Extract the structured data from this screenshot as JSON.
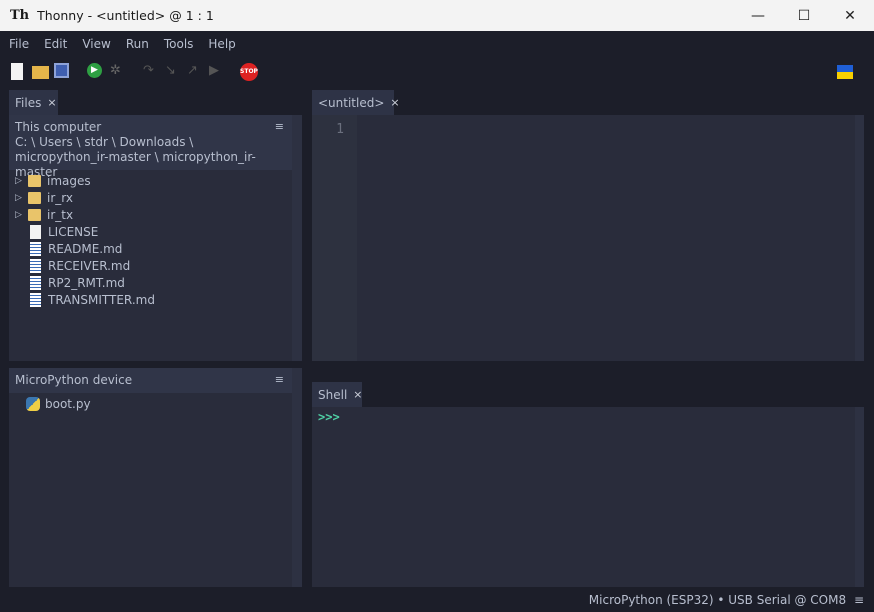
{
  "title": {
    "app": "Thonny",
    "sep": "-",
    "doc": "<untitled>",
    "pos": "@  1 : 1",
    "logo": "Th"
  },
  "window": {
    "minimize": "—",
    "maximize": "☐",
    "close": "✕"
  },
  "menu": [
    "File",
    "Edit",
    "View",
    "Run",
    "Tools",
    "Help"
  ],
  "toolbar": {
    "stop_label": "STOP"
  },
  "files_tab": {
    "label": "Files",
    "close": "×"
  },
  "this_computer": {
    "title": "This computer",
    "path1": "C: \\ Users \\ stdr \\ Downloads \\",
    "path2": "micropython_ir-master \\ micropython_ir-master",
    "menu": "≡"
  },
  "tree": [
    {
      "name": "images",
      "type": "folder"
    },
    {
      "name": "ir_rx",
      "type": "folder"
    },
    {
      "name": "ir_tx",
      "type": "folder"
    },
    {
      "name": "LICENSE",
      "type": "file"
    },
    {
      "name": "README.md",
      "type": "md"
    },
    {
      "name": "RECEIVER.md",
      "type": "md"
    },
    {
      "name": "RP2_RMT.md",
      "type": "md"
    },
    {
      "name": "TRANSMITTER.md",
      "type": "md"
    }
  ],
  "device": {
    "title": "MicroPython device",
    "menu": "≡",
    "files": [
      {
        "name": "boot.py"
      }
    ]
  },
  "editor": {
    "tab": "<untitled>",
    "close": "×",
    "line": "1"
  },
  "shell": {
    "tab": "Shell",
    "close": "×",
    "prompt": ">>>"
  },
  "status": {
    "text": "MicroPython (ESP32)  •  USB Serial @ COM8",
    "menu": "≡"
  },
  "colors": {
    "bg": "#1c1e29",
    "panel": "#292c3b",
    "prompt": "#4fd1a5"
  }
}
